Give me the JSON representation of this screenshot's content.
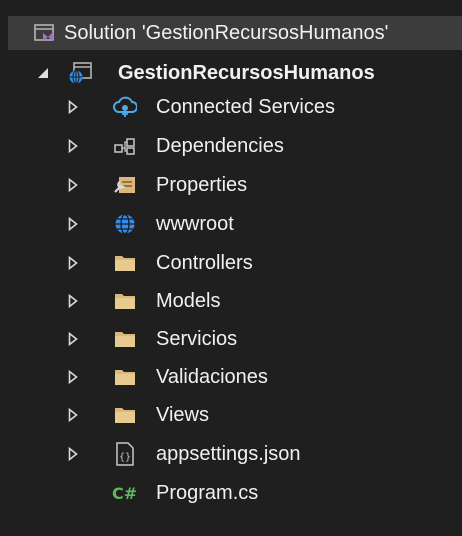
{
  "solution": {
    "label": "Solution 'GestionRecursosHumanos'",
    "icon": "solution-icon"
  },
  "project": {
    "label": "GestionRecursosHumanos",
    "icon": "web-project-icon"
  },
  "items": [
    {
      "label": "Connected Services",
      "icon": "connected-services-icon",
      "expandable": true
    },
    {
      "label": "Dependencies",
      "icon": "dependencies-icon",
      "expandable": true
    },
    {
      "label": "Properties",
      "icon": "properties-icon",
      "expandable": true
    },
    {
      "label": "wwwroot",
      "icon": "globe-icon",
      "expandable": true
    },
    {
      "label": "Controllers",
      "icon": "folder-icon",
      "expandable": true
    },
    {
      "label": "Models",
      "icon": "folder-icon",
      "expandable": true
    },
    {
      "label": "Servicios",
      "icon": "folder-icon",
      "expandable": true
    },
    {
      "label": "Validaciones",
      "icon": "folder-icon",
      "expandable": true
    },
    {
      "label": "Views",
      "icon": "folder-icon",
      "expandable": true
    },
    {
      "label": "appsettings.json",
      "icon": "json-file-icon",
      "expandable": true
    },
    {
      "label": "Program.cs",
      "icon": "csharp-file-icon",
      "expandable": false
    }
  ],
  "colors": {
    "background": "#1f1f1f",
    "selection": "#3c3c3c",
    "folder": "#dcb67a",
    "globe": "#2f8ff0",
    "csharp": "#5fb85f"
  }
}
